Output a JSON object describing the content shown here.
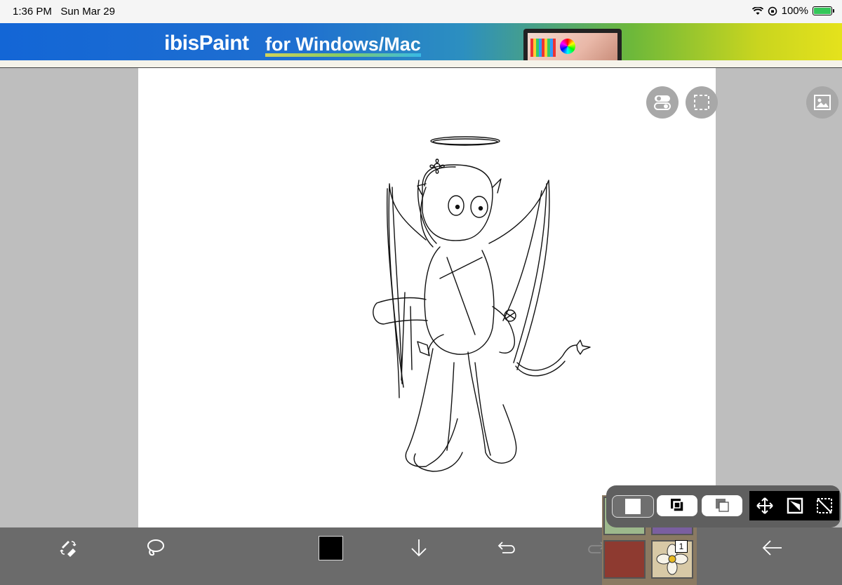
{
  "status": {
    "time": "1:36 PM",
    "date": "Sun Mar 29",
    "battery_text": "100%",
    "battery_level": 1.0
  },
  "ad": {
    "brand": "ibisPaint",
    "tagline": "for Windows/Mac"
  },
  "canvas_tools": {
    "toggle_icon": "toggle-icon",
    "selection_icon": "selection-frame-icon",
    "reference_icon": "image-icon"
  },
  "bottom_toolbar": {
    "tools": [
      "brush-eraser-swap-icon",
      "lasso-icon",
      "color-swatch",
      "arrow-down-icon",
      "undo-icon",
      "redo-icon",
      "layers",
      "back-arrow-icon"
    ],
    "current_color": "#000000"
  },
  "layers": {
    "count_label": "1"
  },
  "selection_panel": {
    "modes": [
      "select-all",
      "select-invert",
      "select-subtract"
    ],
    "tools": [
      "move-icon",
      "transform-icon",
      "deselect-icon"
    ]
  }
}
